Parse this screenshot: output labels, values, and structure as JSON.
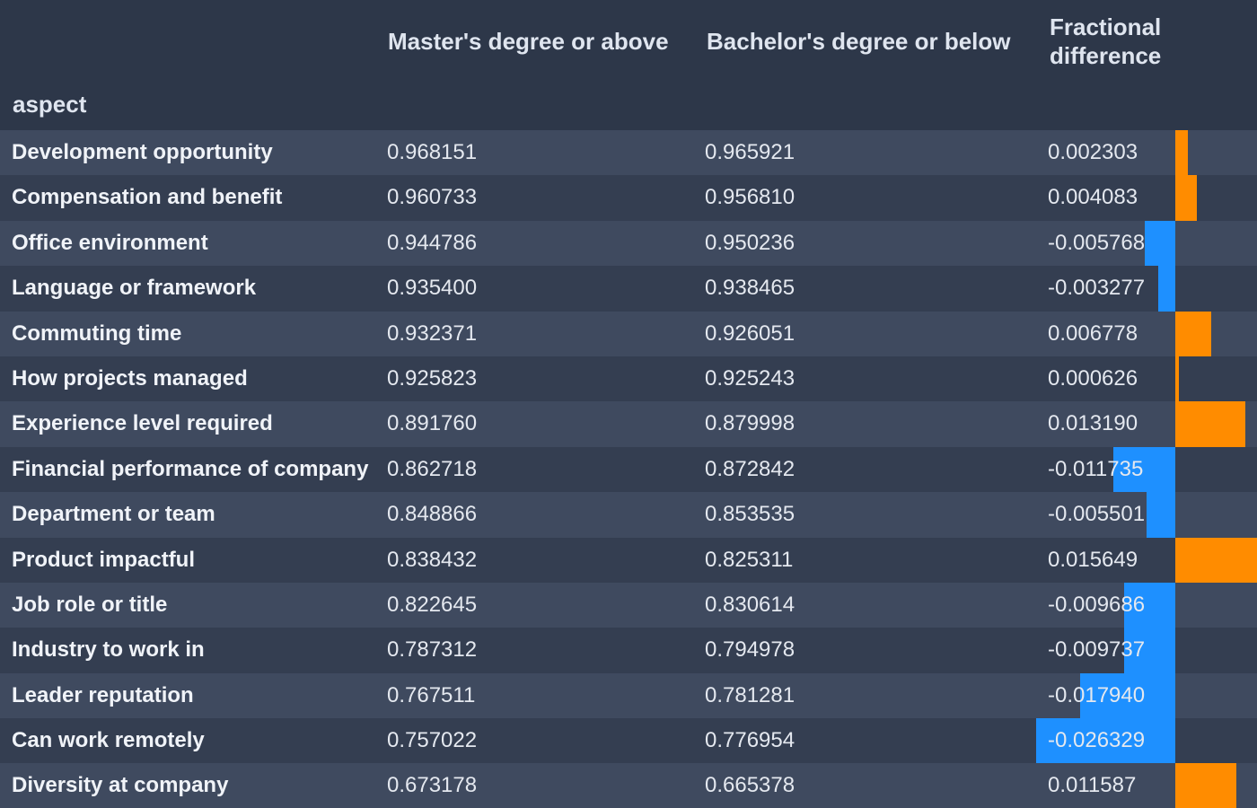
{
  "headers": {
    "aspect": "aspect",
    "col1": "Master's degree or above",
    "col2": "Bachelor's degree or below",
    "col3_line1": "Fractional",
    "col3_line2": "difference"
  },
  "colors": {
    "positive": "#ff8c00",
    "negative": "#1e90ff"
  },
  "chart_data": {
    "type": "table",
    "columns": [
      "aspect",
      "Master's degree or above",
      "Bachelor's degree or below",
      "Fractional difference"
    ],
    "rows": [
      {
        "aspect": "Development opportunity",
        "master": "0.968151",
        "bachelor": "0.965921",
        "diff": "0.002303",
        "diff_value": 0.002303
      },
      {
        "aspect": "Compensation and benefit",
        "master": "0.960733",
        "bachelor": "0.956810",
        "diff": "0.004083",
        "diff_value": 0.004083
      },
      {
        "aspect": "Office environment",
        "master": "0.944786",
        "bachelor": "0.950236",
        "diff": "-0.005768",
        "diff_value": -0.005768
      },
      {
        "aspect": "Language or framework",
        "master": "0.935400",
        "bachelor": "0.938465",
        "diff": "-0.003277",
        "diff_value": -0.003277
      },
      {
        "aspect": "Commuting time",
        "master": "0.932371",
        "bachelor": "0.926051",
        "diff": "0.006778",
        "diff_value": 0.006778
      },
      {
        "aspect": "How projects managed",
        "master": "0.925823",
        "bachelor": "0.925243",
        "diff": "0.000626",
        "diff_value": 0.000626
      },
      {
        "aspect": "Experience level required",
        "master": "0.891760",
        "bachelor": "0.879998",
        "diff": "0.013190",
        "diff_value": 0.01319
      },
      {
        "aspect": "Financial performance of company",
        "master": "0.862718",
        "bachelor": "0.872842",
        "diff": "-0.011735",
        "diff_value": -0.011735
      },
      {
        "aspect": "Department or team",
        "master": "0.848866",
        "bachelor": "0.853535",
        "diff": "-0.005501",
        "diff_value": -0.005501
      },
      {
        "aspect": "Product impactful",
        "master": "0.838432",
        "bachelor": "0.825311",
        "diff": "0.015649",
        "diff_value": 0.015649
      },
      {
        "aspect": "Job role or title",
        "master": "0.822645",
        "bachelor": "0.830614",
        "diff": "-0.009686",
        "diff_value": -0.009686
      },
      {
        "aspect": "Industry to work in",
        "master": "0.787312",
        "bachelor": "0.794978",
        "diff": "-0.009737",
        "diff_value": -0.009737
      },
      {
        "aspect": "Leader reputation",
        "master": "0.767511",
        "bachelor": "0.781281",
        "diff": "-0.017940",
        "diff_value": -0.01794
      },
      {
        "aspect": "Can work remotely",
        "master": "0.757022",
        "bachelor": "0.776954",
        "diff": "-0.026329",
        "diff_value": -0.026329
      },
      {
        "aspect": "Diversity at company",
        "master": "0.673178",
        "bachelor": "0.665378",
        "diff": "0.011587",
        "diff_value": 0.011587
      }
    ]
  }
}
